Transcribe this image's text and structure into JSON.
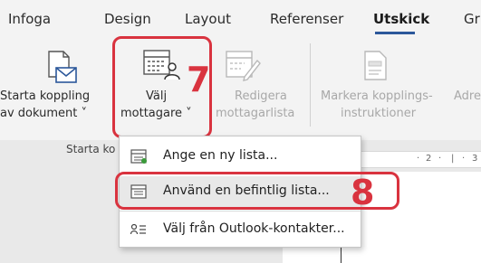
{
  "tabs": [
    {
      "label": "Infoga"
    },
    {
      "label": "Design"
    },
    {
      "label": "Layout"
    },
    {
      "label": "Referenser"
    },
    {
      "label": "Utskick"
    },
    {
      "label": "Gr"
    }
  ],
  "ribbon": {
    "start_merge": {
      "line1": "Starta koppling",
      "line2": "av dokument ˅"
    },
    "select_recipients": {
      "line1": "Välj",
      "line2": "mottagare ˅"
    },
    "edit_list": {
      "line1": "Redigera",
      "line2": "mottagarlista"
    },
    "highlight_fields": {
      "line1": "Markera kopplings-",
      "line2": "instruktioner"
    },
    "address": {
      "line1": "Adre"
    },
    "group_label": "Starta ko"
  },
  "callouts": {
    "step7": "7",
    "step8": "8"
  },
  "menu": {
    "items": [
      {
        "label": "Ange en ny lista..."
      },
      {
        "label": "Använd en befintlig lista..."
      },
      {
        "label": "Välj från Outlook-kontakter..."
      }
    ]
  },
  "ruler": {
    "marks": [
      "·",
      "2",
      "·",
      "|",
      "·",
      "3"
    ]
  },
  "colors": {
    "accent": "#2b579a",
    "callout": "#d9333f",
    "ribbon_bg": "#f3f3f3"
  }
}
